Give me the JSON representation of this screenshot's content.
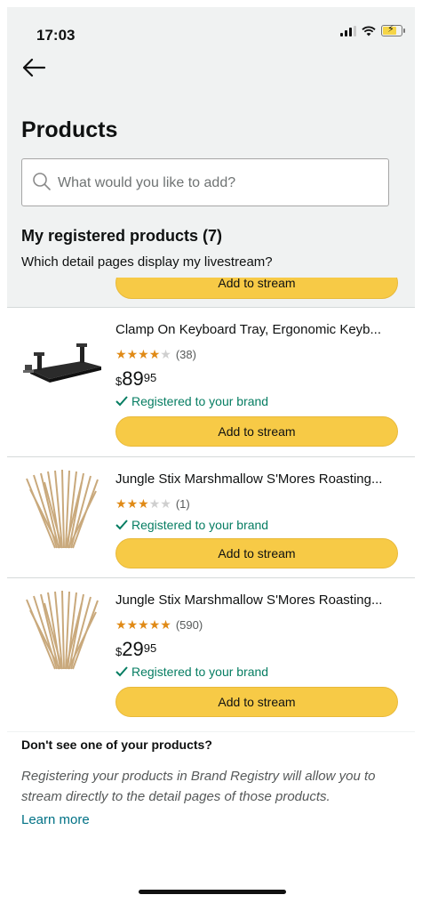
{
  "status_bar": {
    "time": "17:03"
  },
  "header": {
    "back_icon": "arrow-left-icon",
    "title": "Products"
  },
  "search": {
    "placeholder": "What would you like to add?",
    "value": ""
  },
  "section": {
    "title": "My registered products (7)",
    "subtitle": "Which detail pages display my livestream?"
  },
  "partial_button": {
    "label": "Add to stream"
  },
  "products": [
    {
      "title": "Clamp On Keyboard Tray, Ergonomic Keyb...",
      "rating": 4,
      "rating_count": "(38)",
      "price": {
        "currency": "$",
        "whole": "89",
        "fraction": "95"
      },
      "status": "Registered to your brand",
      "button_label": "Add to stream",
      "image": "keyboard-tray-image"
    },
    {
      "title": "Jungle Stix Marshmallow S'Mores Roasting...",
      "rating": 3,
      "rating_count": "(1)",
      "price": null,
      "status": "Registered to your brand",
      "button_label": "Add to stream",
      "image": "roasting-sticks-image"
    },
    {
      "title": "Jungle Stix Marshmallow S'Mores Roasting...",
      "rating": 5,
      "rating_count": "(590)",
      "price": {
        "currency": "$",
        "whole": "29",
        "fraction": "95"
      },
      "status": "Registered to your brand",
      "button_label": "Add to stream",
      "image": "roasting-sticks-image"
    }
  ],
  "footer": {
    "heading": "Don't see one of your products?",
    "text": "Registering your products in Brand Registry will allow you to stream directly to the detail pages of those products.",
    "link": "Learn more"
  },
  "colors": {
    "button_yellow": "#f7ca46",
    "star_orange": "#e08a16",
    "success_green": "#067d62",
    "link_teal": "#007185"
  }
}
